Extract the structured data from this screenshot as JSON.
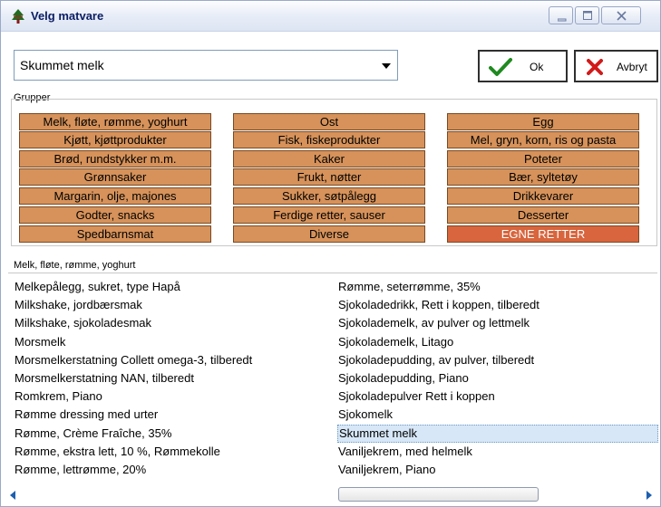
{
  "window": {
    "title": "Velg matvare"
  },
  "food_select": {
    "value": "Skummet melk"
  },
  "buttons": {
    "ok_label": "Ok",
    "cancel_label": "Avbryt"
  },
  "groups": {
    "caption": "Grupper",
    "columns": [
      [
        "Melk, fløte, rømme, yoghurt",
        "Kjøtt, kjøttprodukter",
        "Brød, rundstykker m.m.",
        "Grønnsaker",
        "Margarin, olje, majones",
        "Godter, snacks",
        "Spedbarnsmat"
      ],
      [
        "Ost",
        "Fisk, fiskeprodukter",
        "Kaker",
        "Frukt, nøtter",
        "Sukker, søtpålegg",
        "Ferdige retter, sauser",
        "Diverse"
      ],
      [
        "Egg",
        "Mel, gryn, korn, ris og pasta",
        "Poteter",
        "Bær, syltetøy",
        "Drikkevarer",
        "Desserter",
        "EGNE RETTER"
      ]
    ],
    "active": "EGNE RETTER",
    "colors": {
      "button": "#d6925a",
      "active": "#d8653d"
    }
  },
  "list": {
    "caption": "Melk, fløte, rømme, yoghurt",
    "left": [
      "Melkepålegg, sukret, type Hapå",
      "Milkshake, jordbærsmak",
      "Milkshake, sjokoladesmak",
      "Morsmelk",
      "Morsmelkerstatning Collett omega-3, tilberedt",
      "Morsmelkerstatning NAN, tilberedt",
      "Romkrem, Piano",
      "Rømme dressing med urter",
      "Rømme, Crème Fraîche, 35%",
      "Rømme, ekstra lett, 10 %, Rømmekolle",
      "Rømme, lettrømme, 20%"
    ],
    "right": [
      "Rømme, seterrømme, 35%",
      "Sjokoladedrikk, Rett i koppen, tilberedt",
      "Sjokolademelk, av pulver og lettmelk",
      "Sjokolademelk, Litago",
      "Sjokoladepudding, av pulver, tilberedt",
      "Sjokoladepudding, Piano",
      "Sjokoladepulver Rett i koppen",
      "Sjokomelk",
      "Skummet melk",
      "Vaniljekrem, med helmelk",
      "Vaniljekrem, Piano"
    ],
    "selected": "Skummet melk"
  },
  "icons": {
    "app": "tree-icon",
    "ok": "check-icon",
    "cancel": "x-icon",
    "dropdown": "triangle-down-icon",
    "scroll_left": "triangle-left-icon",
    "scroll_right": "triangle-right-icon"
  }
}
